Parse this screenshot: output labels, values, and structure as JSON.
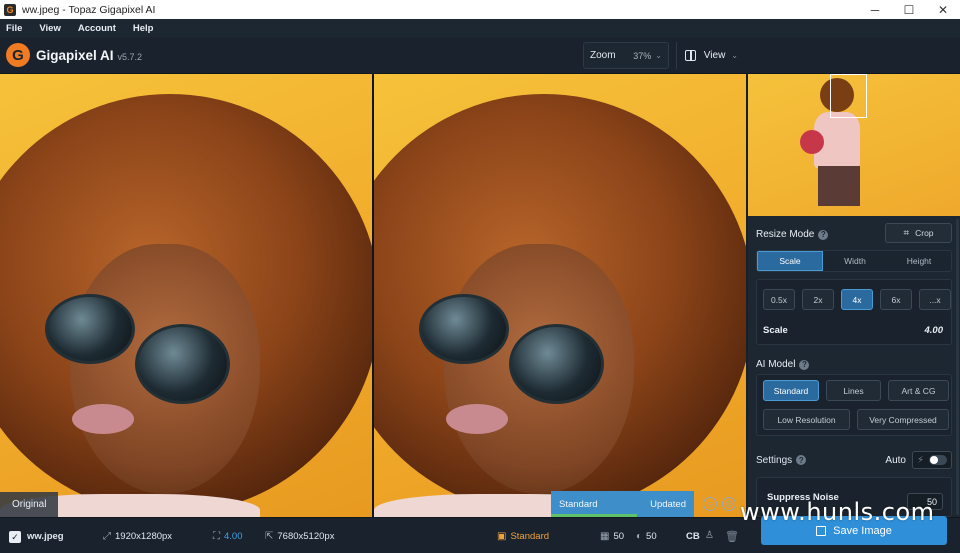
{
  "window": {
    "title": "ww.jpeg - Topaz Gigapixel AI",
    "app_icon": "G",
    "controls": [
      "─",
      "☐",
      "✕"
    ]
  },
  "menu": [
    "File",
    "View",
    "Account",
    "Help"
  ],
  "header": {
    "logo_letter": "G",
    "app_name": "Gigapixel AI",
    "version": "v5.7.2",
    "zoom_label": "Zoom",
    "zoom_value": "37%",
    "view_label": "View"
  },
  "preview": {
    "left_label": "Original",
    "model_name": "Standard",
    "model_status": "Updated"
  },
  "sidebar": {
    "resize_mode_label": "Resize Mode",
    "crop_label": "Crop",
    "resize_tabs": [
      {
        "label": "Scale",
        "active": true
      },
      {
        "label": "Width",
        "active": false
      },
      {
        "label": "Height",
        "active": false
      }
    ],
    "scale_options": [
      {
        "label": "0.5x",
        "active": false
      },
      {
        "label": "2x",
        "active": false
      },
      {
        "label": "4x",
        "active": true
      },
      {
        "label": "6x",
        "active": false
      },
      {
        "label": "...x",
        "active": false
      }
    ],
    "scale_label": "Scale",
    "scale_value": "4.00",
    "ai_model_label": "AI Model",
    "models_row1": [
      {
        "label": "Standard",
        "active": true
      },
      {
        "label": "Lines",
        "active": false
      },
      {
        "label": "Art & CG",
        "active": false
      }
    ],
    "models_row2": [
      {
        "label": "Low Resolution",
        "active": false
      },
      {
        "label": "Very Compressed",
        "active": false
      }
    ],
    "settings_label": "Settings",
    "auto_label": "Auto",
    "suppress_noise_label": "Suppress Noise",
    "suppress_noise_value": "50"
  },
  "statusbar": {
    "filename": "ww.jpeg",
    "original_size": "1920x1280px",
    "scale": "4.00",
    "output_size": "7680x5120px",
    "model": "Standard",
    "noise_value": "50",
    "blur_value": "50",
    "cb": "CB",
    "save_label": "Save Image"
  },
  "watermark": "www.hunls.com",
  "colors": {
    "accent": "#2f8fd8",
    "active_button": "#2b6a9e",
    "brand_orange": "#f07b22",
    "panel": "#1d2731"
  }
}
